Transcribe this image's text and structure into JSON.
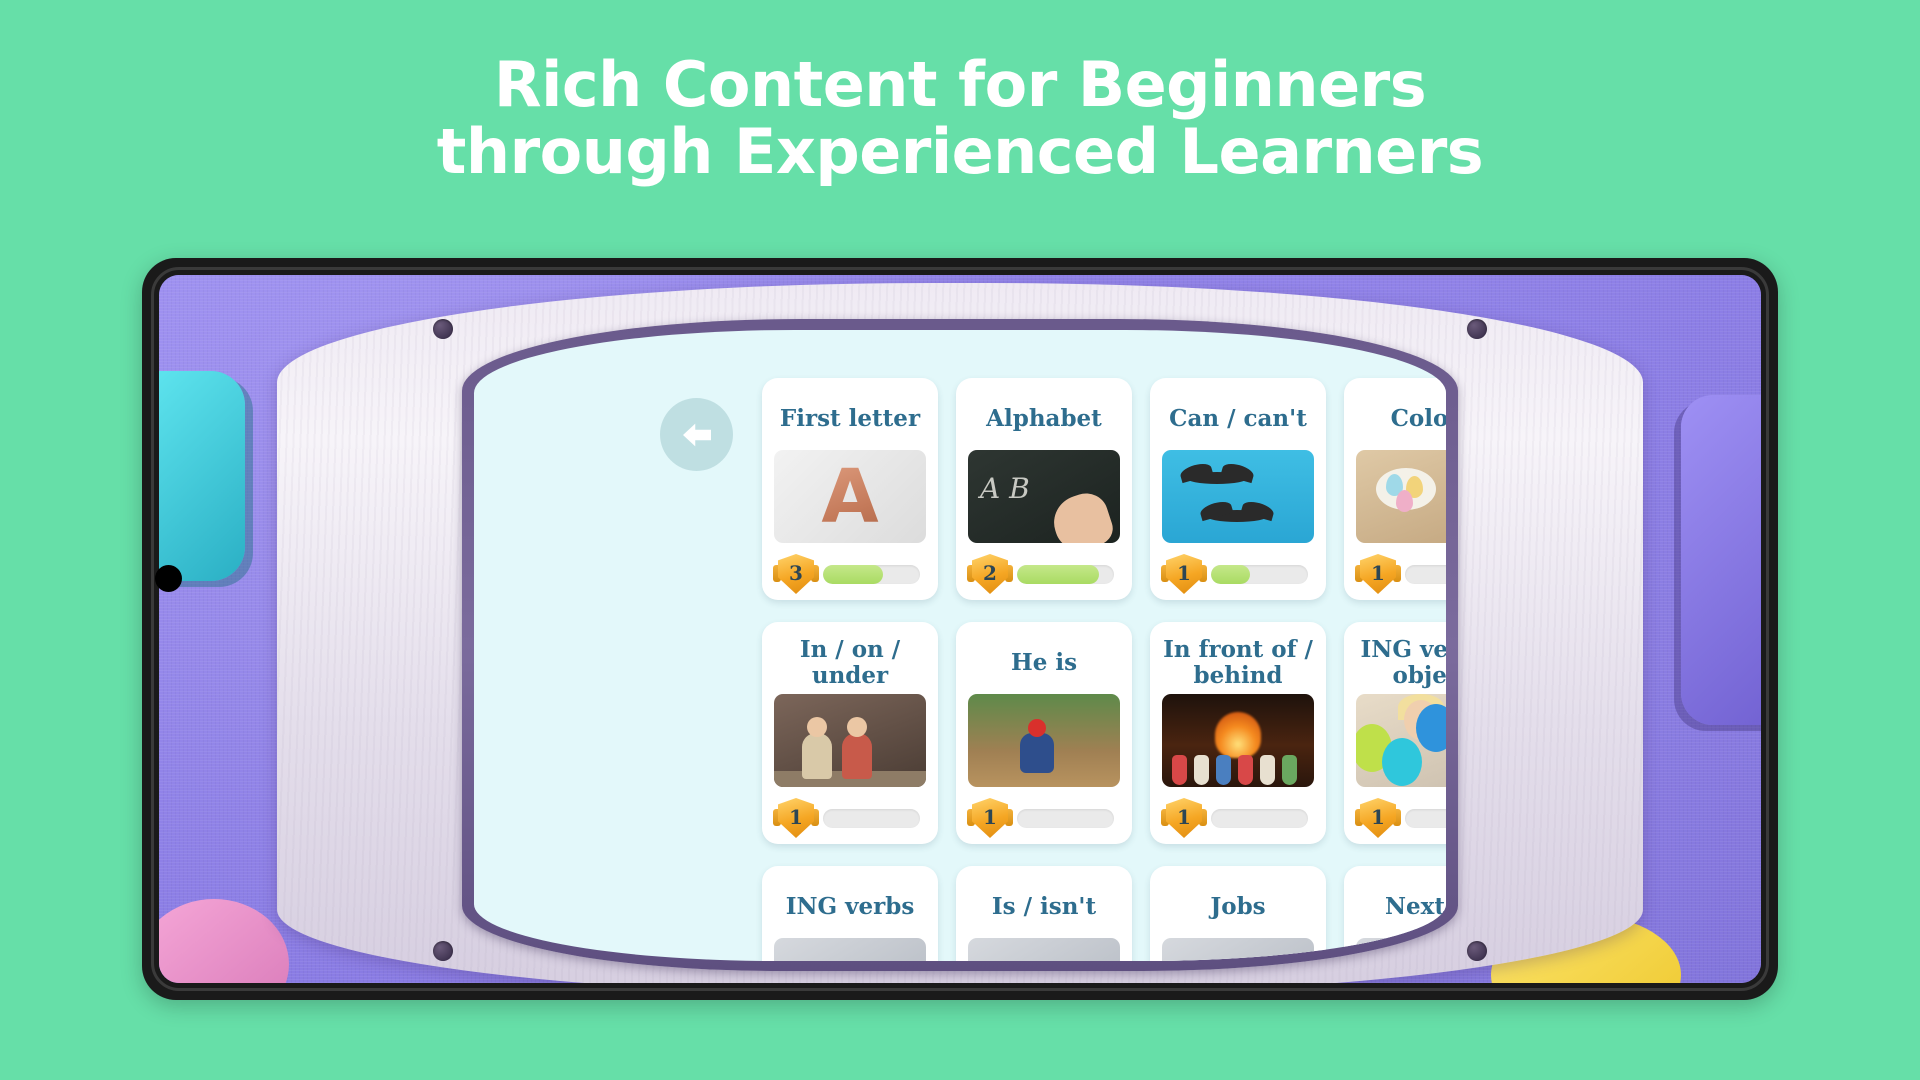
{
  "headline": {
    "line1": "Rich Content for Beginners",
    "line2": "through Experienced Learners"
  },
  "colors": {
    "page_background": "#66DFA8",
    "headline_text": "#FFFFFF",
    "card_title": "#2E6D8E",
    "badge_gold": "#F5A623",
    "progress_fill": "#A9DB63",
    "progress_track": "#EAEAEA",
    "device_bezel": "#1A1A1A",
    "board_screen": "#E3F8FA",
    "board_purple": "#6A5A8C",
    "wall_purple": "#8B7FE8"
  },
  "device": {
    "back_button": {
      "icon": "back-arrow-icon",
      "label": "Back"
    }
  },
  "lesson_grid": {
    "cards": [
      {
        "title": "First letter",
        "badge_level": "3",
        "progress_percent": 62,
        "thumb": "letter-a-balloon-image"
      },
      {
        "title": "Alphabet",
        "badge_level": "2",
        "progress_percent": 85,
        "thumb": "chalkboard-abc-image"
      },
      {
        "title": "Can / can't",
        "badge_level": "1",
        "progress_percent": 40,
        "thumb": "eagles-flying-image"
      },
      {
        "title": "Colors",
        "badge_level": "1",
        "progress_percent": 0,
        "thumb": "painting-eggs-image"
      },
      {
        "title": "In / on / under",
        "badge_level": "1",
        "progress_percent": 0,
        "thumb": "kids-in-car-image"
      },
      {
        "title": "He is",
        "badge_level": "1",
        "progress_percent": 0,
        "thumb": "baseball-player-image"
      },
      {
        "title": "In front of / behind",
        "badge_level": "1",
        "progress_percent": 0,
        "thumb": "socks-by-fireplace-image"
      },
      {
        "title": "ING verb + object",
        "badge_level": "1",
        "progress_percent": 0,
        "thumb": "woman-with-balloons-image"
      },
      {
        "title": "ING verbs",
        "badge_level": "",
        "progress_percent": 0,
        "thumb": "generic-image"
      },
      {
        "title": "Is / isn't",
        "badge_level": "",
        "progress_percent": 0,
        "thumb": "generic-image"
      },
      {
        "title": "Jobs",
        "badge_level": "",
        "progress_percent": 0,
        "thumb": "generic-image"
      },
      {
        "title": "Next to",
        "badge_level": "",
        "progress_percent": 0,
        "thumb": "generic-image"
      }
    ]
  }
}
